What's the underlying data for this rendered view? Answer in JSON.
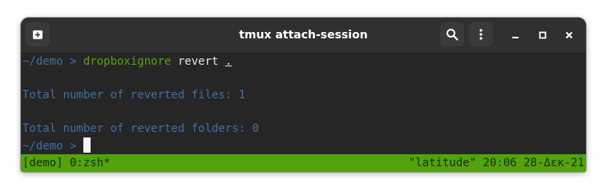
{
  "window": {
    "title": "tmux attach-session"
  },
  "titlebar": {
    "new_tab_icon": "new-tab-icon",
    "search_icon": "search-icon",
    "menu_icon": "kebab-menu-icon",
    "minimize_icon": "minimize-icon",
    "maximize_icon": "maximize-icon",
    "close_icon": "close-icon"
  },
  "terminal": {
    "line1": {
      "prompt": "~/demo > ",
      "command": "dropboxignore",
      "args": " revert ",
      "arg_path": "."
    },
    "line3": "Total number of reverted files: 1",
    "line5": "Total number of reverted folders: 0",
    "line6": {
      "prompt": "~/demo > "
    }
  },
  "statusbar": {
    "left": "[demo] 0:zsh*",
    "right": "\"latitude\" 20:06 28-Δεκ-21"
  },
  "colors": {
    "terminal_bg": "#262626",
    "titlebar_bg": "#303030",
    "prompt_blue": "#3f6fa7",
    "command_green": "#52a30d",
    "statusbar_green": "#52a30d"
  }
}
